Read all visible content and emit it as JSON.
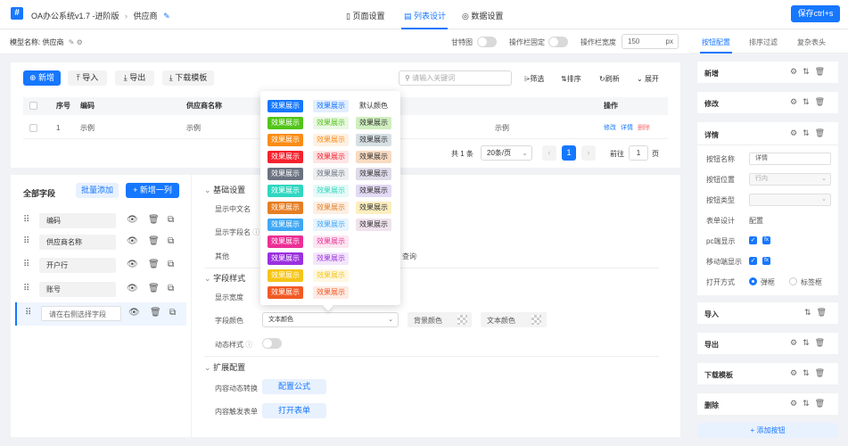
{
  "topbar": {
    "logo": "#",
    "breadcrumb": {
      "app": "OA办公系统v1.7 -进阶版",
      "page": "供应商"
    },
    "tabs": [
      {
        "label": "页面设置",
        "icon": "page-icon"
      },
      {
        "label": "列表设计",
        "icon": "list-icon"
      },
      {
        "label": "数据设置",
        "icon": "data-icon"
      }
    ],
    "save_label": "保存ctrl+s"
  },
  "modelbar": {
    "model_label": "模型名称: 供应商",
    "gantt_label": "甘特图",
    "action_fixed_label": "操作栏固定",
    "action_width_label": "操作栏宽度",
    "action_width_value": "150",
    "action_width_unit": "px"
  },
  "toolbar": {
    "add": "新增",
    "import": "导入",
    "export": "导出",
    "download_template": "下载模板",
    "search_placeholder": "请输入关键词",
    "filter": "筛选",
    "sort": "排序",
    "refresh": "刷新",
    "expand": "展开"
  },
  "table": {
    "headers": [
      "序号",
      "编码",
      "供应商名称",
      "操作"
    ],
    "rows": [
      {
        "index": "1",
        "code": "示例",
        "name": "示例",
        "extra": "示例"
      }
    ],
    "actions": [
      "修改",
      "详情",
      "删除"
    ]
  },
  "pagination": {
    "total": "共 1 条",
    "page_size": "20条/页",
    "current": "1",
    "goto_label": "前往",
    "goto_value": "1",
    "page_unit": "页"
  },
  "fields": {
    "title": "全部字段",
    "batch_add": "批量添加",
    "add_column": "新增一列",
    "items": [
      {
        "name": "编码"
      },
      {
        "name": "供应商名称"
      },
      {
        "name": "开户行"
      },
      {
        "name": "账号"
      },
      {
        "name": "请在右侧选择字段"
      }
    ]
  },
  "settings": {
    "basic_section": "基础设置",
    "show_cn_name": "显示中文名",
    "show_field_name": "显示字段名",
    "other": "其他",
    "query": "查询",
    "style_section": "字段样式",
    "display_width": "显示宽度",
    "field_color": "字段颜色",
    "text_color_select": "文本颜色",
    "bg_color": "背景颜色",
    "text_color": "文本颜色",
    "dynamic_style": "动态样式",
    "ext_section": "扩展配置",
    "content_convert": "内容动态转换",
    "formula_btn": "配置公式",
    "content_trigger": "内容触发表单",
    "open_form_btn": "打开表单"
  },
  "color_popup": {
    "chip_label": "效果展示",
    "default_label": "默认颜色",
    "solid_colors": [
      "#1677ff",
      "#52c41a",
      "#fa8c16",
      "#f5222d",
      "#6b7280",
      "#2fd6c0",
      "#e67e22",
      "#3fa7f5",
      "#eb2f96",
      "#9b30e0",
      "#f5c518",
      "#f15a24"
    ],
    "light_colors": [
      "#1677ff",
      "#52c41a",
      "#fa8c16",
      "#f5222d",
      "#6b7280",
      "#2fd6c0",
      "#e67e22",
      "#3fa7f5",
      "#eb2f96",
      "#9b30e0",
      "#f5c518",
      "#f15a24"
    ],
    "third_colors": [
      "#52c41a",
      "#6b8e9f",
      "#e67e22",
      "#8c7fb0",
      "#9b7bdc",
      "#f5c518",
      "#c89bc0"
    ]
  },
  "right_panel": {
    "tabs": [
      "按钮配置",
      "排序过滤",
      "复杂表头"
    ],
    "cards": {
      "add": "新增",
      "edit": "修改",
      "detail": "详情",
      "import": "导入",
      "export": "导出",
      "download": "下载模板",
      "delete": "删除"
    },
    "detail": {
      "btn_name_label": "按钮名称",
      "btn_name_value": "详情",
      "btn_pos_label": "按钮位置",
      "btn_pos_value": "行内",
      "btn_type_label": "按钮类型",
      "form_design_label": "表单设计",
      "form_design_link": "配置",
      "pc_show_label": "pc端显示",
      "mobile_show_label": "移动端显示",
      "open_mode_label": "打开方式",
      "open_popup": "弹框",
      "open_tab": "标签框"
    },
    "add_button": "添加按钮"
  },
  "colors": {
    "primary": "#1677ff",
    "danger": "#f56c6c"
  }
}
